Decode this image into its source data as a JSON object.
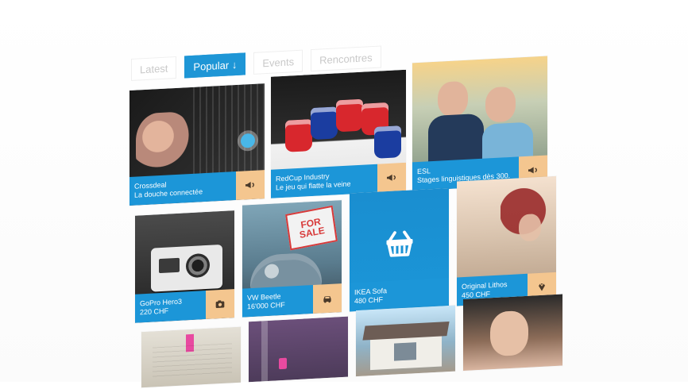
{
  "tabs": [
    {
      "label": "Latest",
      "active": false
    },
    {
      "label": "Popular ↓",
      "active": true
    },
    {
      "label": "Events",
      "active": false
    },
    {
      "label": "Rencontres",
      "active": false
    }
  ],
  "tiles": [
    {
      "id": "t1",
      "caption": [
        "Crossdeal",
        "La douche connectée"
      ],
      "badge_icon": "megaphone-icon"
    },
    {
      "id": "t2",
      "caption": [
        "RedCup Industry",
        "Le jeu qui flatte la veine"
      ],
      "badge_icon": "megaphone-icon"
    },
    {
      "id": "t3",
      "caption": [
        "ESL",
        "Stages linguistiques dès 300."
      ],
      "badge_icon": "megaphone-icon"
    },
    {
      "id": "t4",
      "caption": [
        "GoPro Hero3",
        "220 CHF"
      ],
      "badge_icon": "camera-icon"
    },
    {
      "id": "t5",
      "caption": [
        "VW Beetle",
        "16'000 CHF"
      ],
      "badge_icon": "car-icon",
      "sign": [
        "FOR",
        "SALE"
      ]
    },
    {
      "id": "t6",
      "caption": [
        "IKEA Sofa",
        "480 CHF"
      ],
      "badge_icon": "basket-icon"
    },
    {
      "id": "t7",
      "caption": [
        "Original Lithos",
        "450 CHF"
      ],
      "badge_icon": "diamond-icon"
    }
  ],
  "colors": {
    "accent": "#1e96d6",
    "badge": "#f4c68f"
  }
}
